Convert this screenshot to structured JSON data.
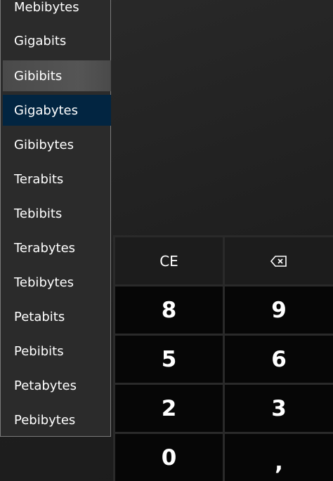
{
  "unit_list": {
    "items": [
      {
        "label": "Mebibytes",
        "state": "normal"
      },
      {
        "label": "Gigabits",
        "state": "normal"
      },
      {
        "label": "Gibibits",
        "state": "hover"
      },
      {
        "label": "Gigabytes",
        "state": "selected"
      },
      {
        "label": "Gibibytes",
        "state": "normal"
      },
      {
        "label": "Terabits",
        "state": "normal"
      },
      {
        "label": "Tebibits",
        "state": "normal"
      },
      {
        "label": "Terabytes",
        "state": "normal"
      },
      {
        "label": "Tebibytes",
        "state": "normal"
      },
      {
        "label": "Petabits",
        "state": "normal"
      },
      {
        "label": "Pebibits",
        "state": "normal"
      },
      {
        "label": "Petabytes",
        "state": "normal"
      },
      {
        "label": "Pebibytes",
        "state": "normal"
      }
    ]
  },
  "keypad": {
    "ce": "CE",
    "backspace_icon": "backspace-icon",
    "keys": [
      "8",
      "9",
      "5",
      "6",
      "2",
      "3",
      "0",
      ","
    ]
  },
  "colors": {
    "selected": "#022541",
    "hover": "#4a4a4a"
  }
}
